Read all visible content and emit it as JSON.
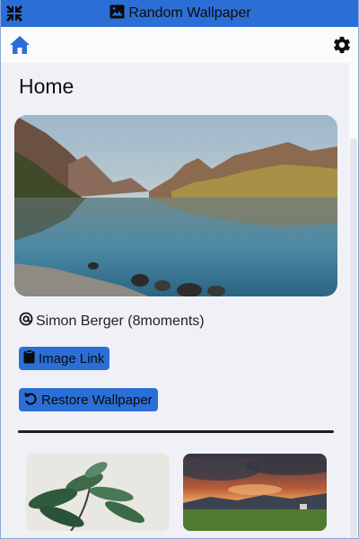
{
  "window": {
    "title": "Random Wallpaper",
    "title_icon": "image-icon",
    "shrink_icon": "shrink-arrows-icon"
  },
  "toolbar": {
    "home_icon": "home-icon",
    "settings_icon": "gear-icon"
  },
  "page": {
    "title": "Home"
  },
  "current_wallpaper": {
    "credit": "Simon Berger (8moments)",
    "credit_icon": "at-sign-icon"
  },
  "actions": {
    "image_link_label": "Image Link",
    "image_link_icon": "clipboard-icon",
    "restore_label": "Restore Wallpaper",
    "restore_icon": "undo-icon"
  },
  "history": {
    "items": [
      {
        "icon": "plant-leaves-thumbnail"
      },
      {
        "icon": "sunset-landscape-thumbnail"
      }
    ]
  },
  "colors": {
    "accent": "#2b6fd6",
    "background": "#f0f1f7",
    "divider": "#1c1c1c"
  }
}
